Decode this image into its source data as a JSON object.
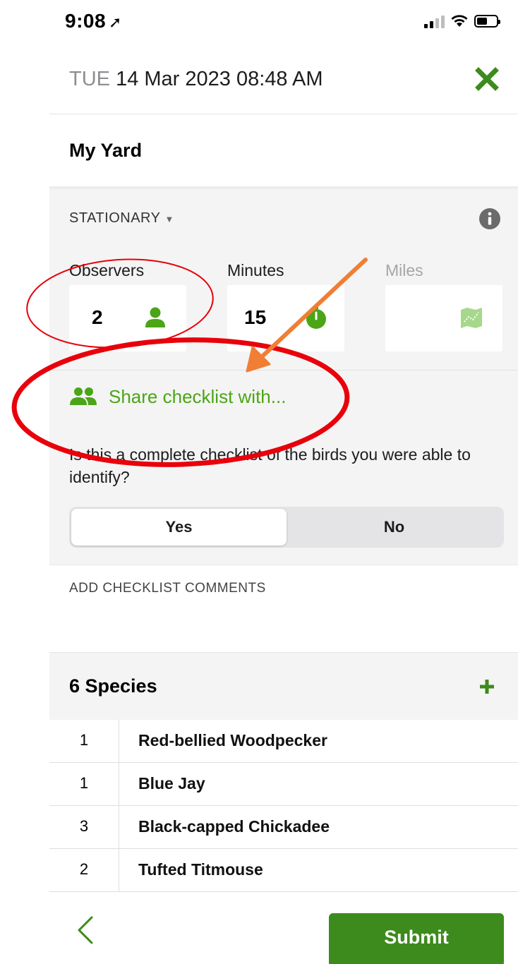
{
  "status_bar": {
    "time": "9:08",
    "location_arrow": "location-arrow-icon"
  },
  "header": {
    "day_of_week": "TUE",
    "date_time": "14 Mar 2023 08:48 AM",
    "close_icon": "close-x-icon"
  },
  "location": {
    "name": "My Yard"
  },
  "protocol": {
    "label": "STATIONARY",
    "caret": "▼"
  },
  "fields": {
    "observers": {
      "label": "Observers",
      "value": "2",
      "icon": "person-icon"
    },
    "minutes": {
      "label": "Minutes",
      "value": "15",
      "icon": "stopwatch-icon"
    },
    "miles": {
      "label": "Miles",
      "value": "",
      "icon": "map-track-icon"
    }
  },
  "share": {
    "label": "Share checklist with...",
    "icon": "people-icon"
  },
  "complete": {
    "question": "Is this a complete checklist of the birds you were able to identify?",
    "options": [
      "Yes",
      "No"
    ],
    "selected": "Yes"
  },
  "comments": {
    "label": "ADD CHECKLIST COMMENTS"
  },
  "species": {
    "header": "6 Species",
    "rows": [
      {
        "count": "1",
        "name": "Red-bellied Woodpecker"
      },
      {
        "count": "1",
        "name": "Blue Jay"
      },
      {
        "count": "3",
        "name": "Black-capped Chickadee"
      },
      {
        "count": "2",
        "name": "Tufted Titmouse"
      }
    ]
  },
  "footer": {
    "submit_label": "Submit"
  },
  "colors": {
    "brand_green": "#3d8a1d",
    "accent_green": "#4ba516",
    "annotation_red": "#e8000b",
    "annotation_orange": "#f07e34"
  }
}
